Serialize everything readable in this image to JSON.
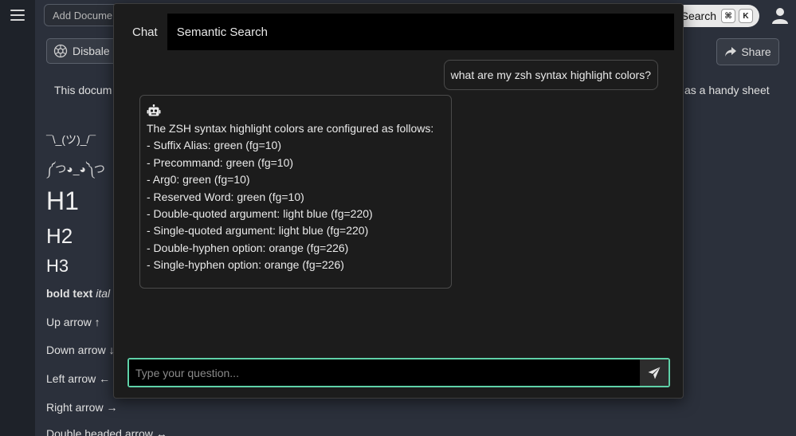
{
  "topbar": {
    "add_document_placeholder": "Add Document",
    "search_label": "Search",
    "shortcut_cmd": "⌘",
    "shortcut_key": "K",
    "menu_icon": "hamburger-icon",
    "user_icon": "user-icon"
  },
  "document": {
    "disable_button": "Disbale",
    "share_button": "Share",
    "intro_start": "This docum",
    "intro_end": "as a handy sheet",
    "shrug": "¯\\_(ツ)_/¯",
    "lenny": "༼つ◕_◕༽つ",
    "h1": "H1",
    "h2": "H2",
    "h3": "H3",
    "bold_text": "bold text",
    "italic_text": "ital",
    "up_arrow": "Up arrow ↑",
    "down_arrow": "Down arrow ↓",
    "left_arrow": "Left arrow ←",
    "right_arrow": "Right arrow →",
    "double_arrow": "Double headed arrow ↔"
  },
  "modal": {
    "tabs": [
      {
        "label": "Chat",
        "active": true
      },
      {
        "label": "Semantic Search",
        "active": false
      }
    ],
    "user_message": "what are my zsh syntax highlight colors?",
    "bot_lines": [
      "The ZSH syntax highlight colors are configured as follows:",
      "- Suffix Alias: green (fg=10)",
      "- Precommand: green (fg=10)",
      "- Arg0: green (fg=10)",
      "- Reserved Word: green (fg=10)",
      "- Double-quoted argument: light blue (fg=220)",
      "- Single-quoted argument: light blue (fg=220)",
      "- Double-hyphen option: orange (fg=226)",
      "- Single-hyphen option: orange (fg=226)"
    ],
    "input_placeholder": "Type your question...",
    "accent_color": "#5fd1a8"
  }
}
